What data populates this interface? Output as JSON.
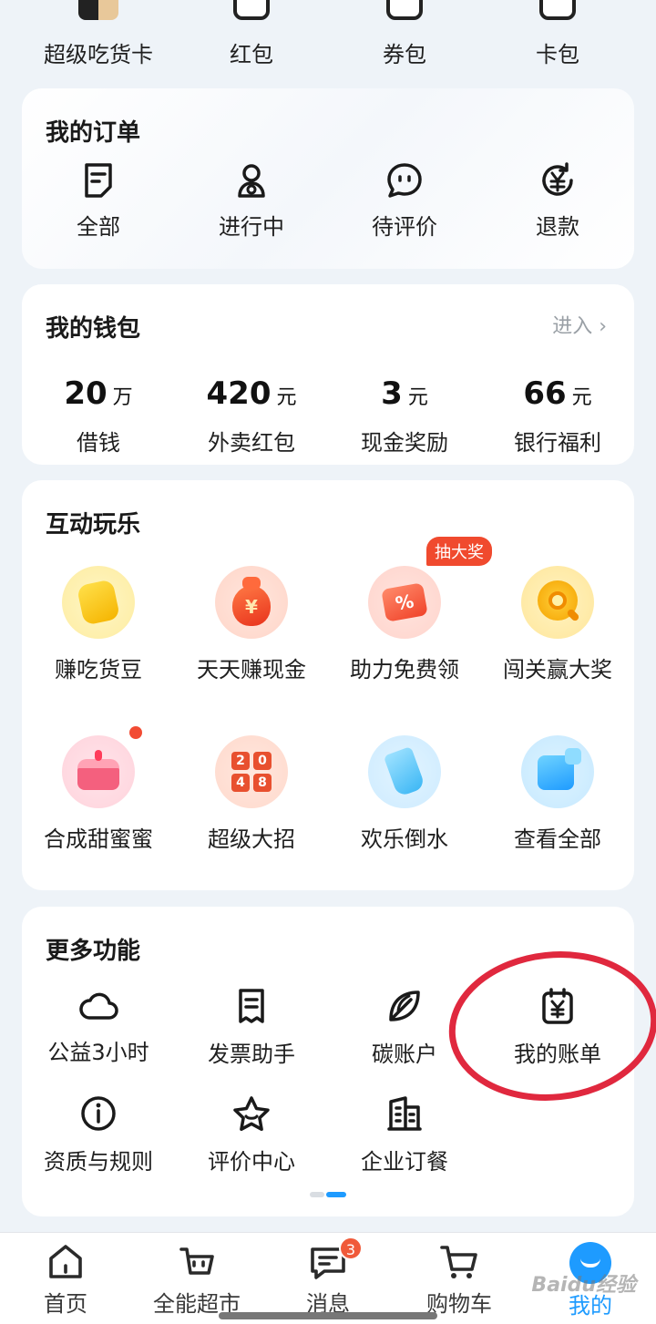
{
  "top_row": [
    {
      "label": "超级吃货卡",
      "icon": "card-art-icon"
    },
    {
      "label": "红包",
      "icon": "red-packet-icon"
    },
    {
      "label": "券包",
      "icon": "coupon-icon"
    },
    {
      "label": "卡包",
      "icon": "wallet-icon"
    }
  ],
  "orders": {
    "title": "我的订单",
    "items": [
      {
        "label": "全部",
        "icon": "document-icon"
      },
      {
        "label": "进行中",
        "icon": "rider-icon"
      },
      {
        "label": "待评价",
        "icon": "chat-bubble-icon"
      },
      {
        "label": "退款",
        "icon": "refund-yen-icon"
      }
    ]
  },
  "wallet": {
    "title": "我的钱包",
    "enter_label": "进入 ›",
    "items": [
      {
        "value": "20",
        "unit": "万",
        "label": "借钱"
      },
      {
        "value": "420",
        "unit": "元",
        "label": "外卖红包"
      },
      {
        "value": "3",
        "unit": "元",
        "label": "现金奖励"
      },
      {
        "value": "66",
        "unit": "元",
        "label": "银行福利"
      }
    ]
  },
  "games": {
    "title": "互动玩乐",
    "badge": "抽大奖",
    "items": [
      {
        "label": "赚吃货豆",
        "icon": "bean-icon"
      },
      {
        "label": "天天赚现金",
        "icon": "money-bag-icon"
      },
      {
        "label": "助力免费领",
        "icon": "coupon-percent-icon"
      },
      {
        "label": "闯关赢大奖",
        "icon": "gold-medal-icon"
      },
      {
        "label": "合成甜蜜蜜",
        "icon": "cake-icon"
      },
      {
        "label": "超级大招",
        "icon": "2048-icon"
      },
      {
        "label": "欢乐倒水",
        "icon": "water-cup-icon"
      },
      {
        "label": "查看全部",
        "icon": "cube-icon"
      }
    ],
    "tiles_2048": [
      "2",
      "0",
      "4",
      "8"
    ]
  },
  "more": {
    "title": "更多功能",
    "items": [
      {
        "label": "公益3小时",
        "icon": "cloud-heart-icon"
      },
      {
        "label": "发票助手",
        "icon": "invoice-icon"
      },
      {
        "label": "碳账户",
        "icon": "leaf-icon"
      },
      {
        "label": "我的账单",
        "icon": "bill-yen-icon"
      },
      {
        "label": "资质与规则",
        "icon": "info-icon"
      },
      {
        "label": "评价中心",
        "icon": "star-icon"
      },
      {
        "label": "企业订餐",
        "icon": "building-icon"
      }
    ]
  },
  "tabbar": {
    "items": [
      {
        "label": "首页",
        "icon": "home-icon"
      },
      {
        "label": "全能超市",
        "icon": "supermarket-bag-icon"
      },
      {
        "label": "消息",
        "icon": "message-icon",
        "badge": "3"
      },
      {
        "label": "购物车",
        "icon": "cart-icon"
      },
      {
        "label": "我的",
        "icon": "profile-icon",
        "active": true
      }
    ]
  },
  "colors": {
    "accent": "#1e9bff",
    "badge_red": "#f04a2e",
    "annotation_circle": "#e0283e",
    "background": "#eef3f8"
  },
  "watermark": "Baidu经验"
}
